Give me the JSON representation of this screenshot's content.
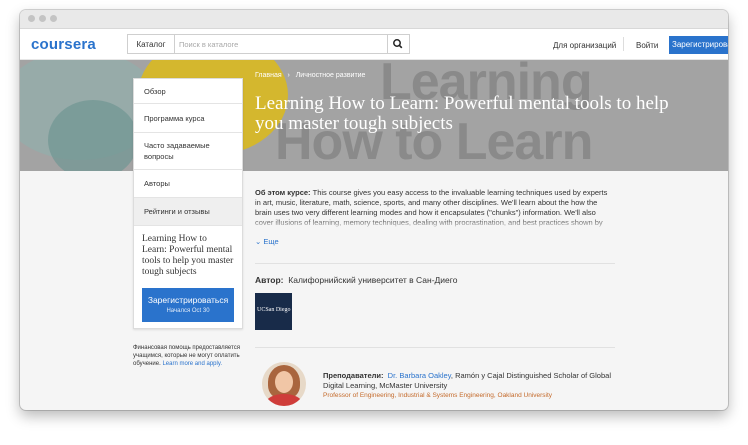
{
  "header": {
    "logo": "coursera",
    "catalog_label": "Каталог",
    "search_placeholder": "Поиск в каталоге",
    "for_orgs": "Для организаций",
    "login": "Войти",
    "signup": "Зарегистрироваться"
  },
  "hero": {
    "bg_line1": "Learning",
    "bg_line2": "How to Learn",
    "breadcrumb": [
      "Главная",
      "Личностное развитие"
    ],
    "title": "Learning How to Learn: Powerful mental tools to help you master tough subjects"
  },
  "sidebar": {
    "items": [
      "Обзор",
      "Программа курса",
      "Часто задаваемые вопросы",
      "Авторы",
      "Рейтинги и отзывы"
    ],
    "card_title": "Learning How to Learn: Powerful mental tools to help you master tough subjects",
    "signup": "Зарегистрироваться",
    "started": "Начался Oct 30"
  },
  "finaid": {
    "text": "Финансовая помощь предоставляется учащимся, которые не могут оплатить обучение.",
    "link": "Learn more and apply."
  },
  "about": {
    "label": "Об этом курсе:",
    "text": "This course gives you easy access to the invaluable learning techniques used by experts in art, music, literature, math, science, sports, and many other disciplines. We'll learn about the how the brain uses two very different learning modes and how it encapsulates (\"chunks\") information. We'll also cover illusions of learning, memory techniques, dealing with procrastination, and best practices shown by",
    "more": "Еще"
  },
  "author": {
    "label": "Автор:",
    "name": "Калифорнийский университет в Сан-Диего",
    "logo_text": "UCSan Diego"
  },
  "instructors": {
    "label": "Преподаватели:",
    "name": "Dr. Barbara Oakley",
    "rest": ", Ramón y Cajal Distinguished Scholar of Global Digital Learning, McMaster University",
    "title": "Professor of Engineering, Industrial & Systems Engineering, Oakland University"
  },
  "colors": {
    "accent": "#2a73cc",
    "hero_gray": "#a3a3a3",
    "hero_yellow": "#d4b72e",
    "instructor_title": "#c46a2b"
  }
}
